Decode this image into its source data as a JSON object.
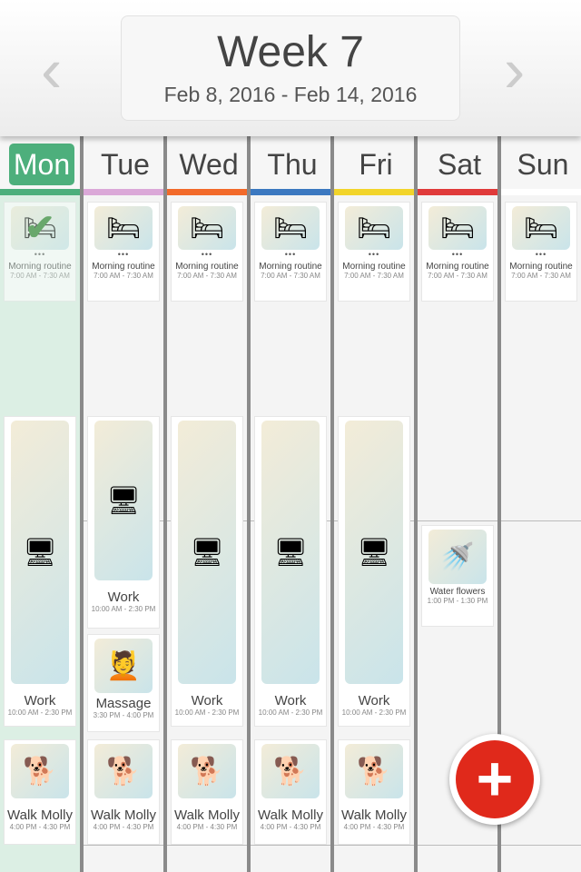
{
  "header": {
    "title": "Week 7",
    "date_range": "Feb 8, 2016 - Feb 14, 2016",
    "prev_icon": "chevron-left-icon",
    "next_icon": "chevron-right-icon"
  },
  "days": [
    {
      "label": "Mon",
      "color": "#4caf7c",
      "selected": true
    },
    {
      "label": "Tue",
      "color": "#dba8d8"
    },
    {
      "label": "Wed",
      "color": "#f26a2a"
    },
    {
      "label": "Thu",
      "color": "#3b78c0"
    },
    {
      "label": "Fri",
      "color": "#f2d42a"
    },
    {
      "label": "Sat",
      "color": "#e03a3a"
    },
    {
      "label": "Sun",
      "color": "#ffffff"
    }
  ],
  "events": {
    "morning": {
      "name": "Morning routine",
      "time": "7:00 AM - 7:30 AM",
      "dots": "•••"
    },
    "work": {
      "name": "Work",
      "time": "10:00 AM - 2:30 PM"
    },
    "massage": {
      "name": "Massage",
      "time": "3:30 PM - 4:00 PM"
    },
    "flowers": {
      "name": "Water flowers",
      "time": "1:00 PM - 1:30 PM"
    },
    "walk": {
      "name": "Walk Molly",
      "time": "4:00 PM - 4:30 PM"
    }
  },
  "completed_icon": "checkmark-icon",
  "fab": {
    "label": "+",
    "color": "#e0291b"
  }
}
